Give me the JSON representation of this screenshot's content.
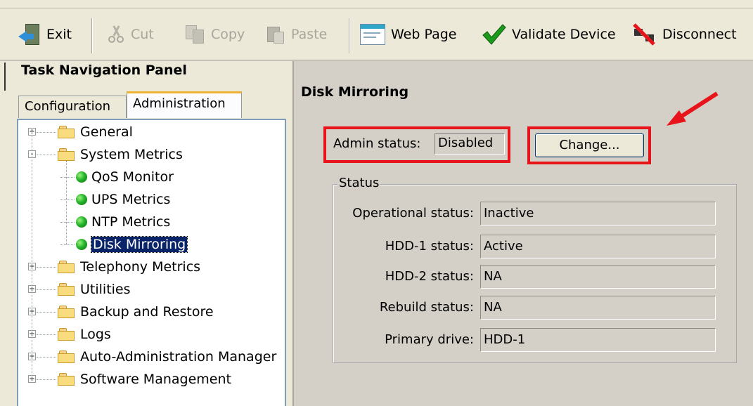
{
  "toolbar": {
    "exit": "Exit",
    "cut": "Cut",
    "copy": "Copy",
    "paste": "Paste",
    "web_page": "Web Page",
    "validate": "Validate Device",
    "disconnect": "Disconnect"
  },
  "nav": {
    "title": "Task Navigation Panel",
    "tabs": [
      "Configuration",
      "Administration"
    ],
    "active_tab": "Administration",
    "tree": [
      {
        "label": "General",
        "type": "folder",
        "expander": "+"
      },
      {
        "label": "System Metrics",
        "type": "folder",
        "expander": "-"
      },
      {
        "label": "QoS Monitor",
        "type": "leaf"
      },
      {
        "label": "UPS Metrics",
        "type": "leaf"
      },
      {
        "label": "NTP Metrics",
        "type": "leaf"
      },
      {
        "label": "Disk Mirroring",
        "type": "leaf",
        "selected": true
      },
      {
        "label": "Telephony Metrics",
        "type": "folder",
        "expander": "+"
      },
      {
        "label": "Utilities",
        "type": "folder",
        "expander": "+"
      },
      {
        "label": "Backup and Restore",
        "type": "folder",
        "expander": "+"
      },
      {
        "label": "Logs",
        "type": "folder",
        "expander": "+"
      },
      {
        "label": "Auto-Administration Manager",
        "type": "folder",
        "expander": "+"
      },
      {
        "label": "Software Management",
        "type": "folder",
        "expander": "+"
      }
    ]
  },
  "main": {
    "title": "Disk Mirroring",
    "admin_status_label": "Admin status:",
    "admin_status_value": "Disabled",
    "change_button": "Change...",
    "status_group_label": "Status",
    "status_rows": [
      {
        "label": "Operational status:",
        "value": "Inactive"
      },
      {
        "label": "HDD-1 status:",
        "value": "Active"
      },
      {
        "label": "HDD-2 status:",
        "value": "NA"
      },
      {
        "label": "Rebuild status:",
        "value": "NA"
      },
      {
        "label": "Primary drive:",
        "value": "HDD-1"
      }
    ]
  },
  "colors": {
    "highlight_red": "#e8141c",
    "selection": "#0a246a",
    "panel_bg": "#d4d0c8"
  }
}
